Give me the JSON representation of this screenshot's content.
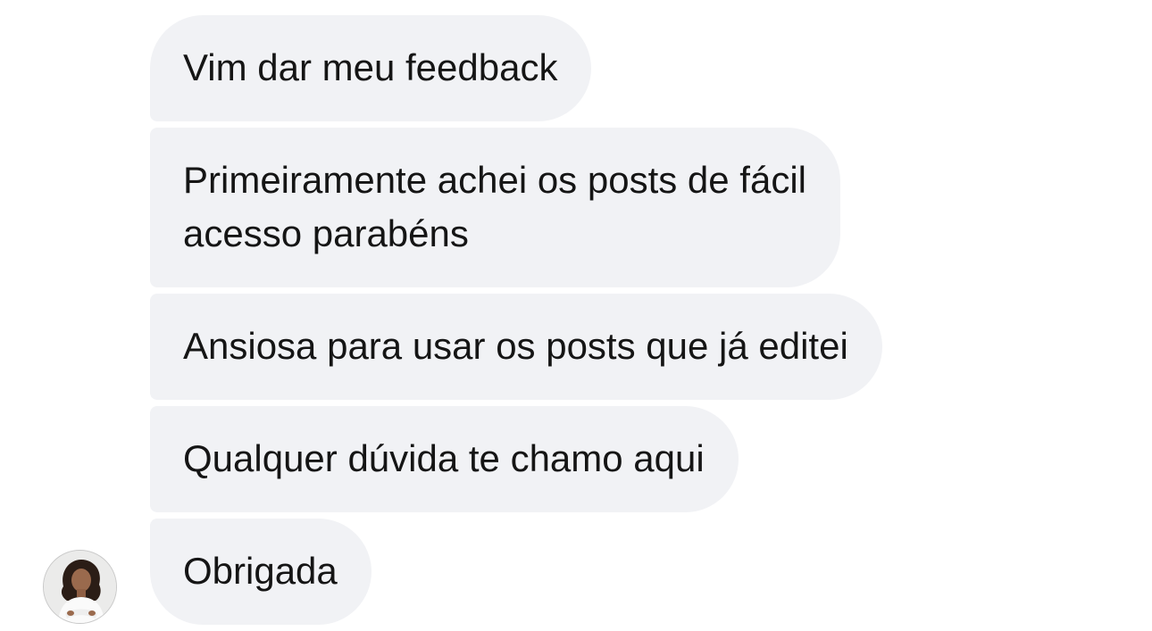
{
  "messages": [
    {
      "text": "Vim dar meu feedback"
    },
    {
      "line1": "Primeiramente achei os posts de fácil",
      "line2": "acesso parabéns"
    },
    {
      "text": "Ansiosa para usar os posts que já editei"
    },
    {
      "text": "Qualquer dúvida te chamo aqui"
    },
    {
      "text": "Obrigada"
    }
  ],
  "colors": {
    "bubble_bg": "#f1f2f5",
    "text": "#151515",
    "background": "#ffffff"
  },
  "avatar": {
    "icon": "user-avatar-photo"
  }
}
